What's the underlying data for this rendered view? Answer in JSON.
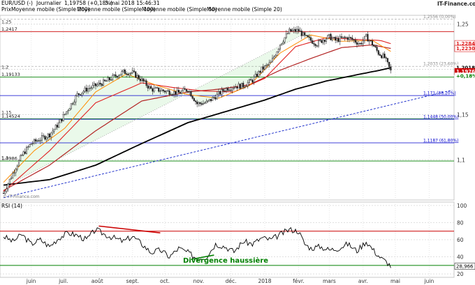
{
  "header": {
    "symbol": "EUR/USD (-)",
    "period": "Journalier",
    "price": "1,19758 (+0,18%)",
    "datetime": "3 mai 2018 15:46:31",
    "brand": "IT-Finance.com",
    "watermark": "© IT-Finance.com"
  },
  "legend": {
    "label": "Prix",
    "items": [
      {
        "text": "Moyenne mobile (Simple 200)",
        "color": "#000000"
      },
      {
        "text": "Moyenne mobile (Simple 100)",
        "color": "#b22222"
      },
      {
        "text": "Moyenne mobile (Simple 50)",
        "color": "#e02020"
      },
      {
        "text": "Moyenne mobile (Simple 20)",
        "color": "#ff8c00"
      }
    ]
  },
  "colors": {
    "candle": "#222222",
    "ma200": "#000000",
    "ma100": "#b22222",
    "ma50": "#e02020",
    "ma20": "#ff8c00",
    "resistance": "#cc0000",
    "support": "#008000",
    "fib": "#0000cc",
    "trend_fill": "#e8f8e8",
    "rsi_line": "#000000",
    "rsi_div_bear": "#cc0000",
    "rsi_div_bull": "#008000",
    "price_badge_pos": "#008000"
  },
  "chart_data": [
    {
      "type": "line",
      "name": "price-panel",
      "ylim": [
        1.0555,
        1.2597
      ],
      "yticks": [
        {
          "value": 1.25,
          "label": "1,25"
        },
        {
          "value": 1.2,
          "label": "1,2"
        },
        {
          "value": 1.15,
          "label": "1,15"
        },
        {
          "value": 1.1,
          "label": "1,1"
        }
      ],
      "xticks": [
        {
          "t": 18,
          "label": "juin"
        },
        {
          "t": 39,
          "label": "juil."
        },
        {
          "t": 61,
          "label": "août"
        },
        {
          "t": 84,
          "label": "sept."
        },
        {
          "t": 105,
          "label": "oct."
        },
        {
          "t": 127,
          "label": "nov."
        },
        {
          "t": 148,
          "label": "déc."
        },
        {
          "t": 170,
          "label": "2018"
        },
        {
          "t": 192,
          "label": "févr."
        },
        {
          "t": 212,
          "label": "mars"
        },
        {
          "t": 234,
          "label": "avr."
        },
        {
          "t": 255,
          "label": "mai"
        },
        {
          "t": 277,
          "label": "juin"
        }
      ],
      "levels_left": [
        {
          "value": 1.2417,
          "label": "1,2417",
          "color": "#cc0000"
        },
        {
          "value": 1.19133,
          "label": "1,19133",
          "color": "#008000"
        },
        {
          "value": 1.14524,
          "label": "1,14524",
          "color": "#008000"
        },
        {
          "value": 1.0986,
          "label": "1,0986",
          "color": "#008000"
        }
      ],
      "levels_right": [
        {
          "value": 1.2556,
          "label": "1,2556 (0,00%)",
          "color": "#888888"
        },
        {
          "value": 1.2033,
          "label": "1,2033 (23,60%)",
          "color": "#888888"
        },
        {
          "value": 1.171,
          "label": "1,171 (38,20%)",
          "color": "#0000cc"
        },
        {
          "value": 1.1448,
          "label": "1,1448 (50,00%)",
          "color": "#0000cc"
        },
        {
          "value": 1.1187,
          "label": "1,1187 (61,80%)",
          "color": "#0000cc"
        }
      ],
      "price_badges": [
        {
          "value": 1.22842,
          "label": "1,22842",
          "color": "#e02020"
        },
        {
          "value": 1.22306,
          "label": "1,22306",
          "color": "#e02020"
        },
        {
          "value": 1.22301,
          "label": "1,22301",
          "color": "#e02020"
        },
        {
          "value": 1.20183,
          "label": "1,20183",
          "color": "#000000"
        },
        {
          "value": 1.19763,
          "label": "1,19763",
          "color": "#ffffff"
        },
        {
          "value": 1.1928,
          "label": "+0,18%",
          "color": "#008000"
        }
      ],
      "close_anchors": [
        [
          0,
          1.063
        ],
        [
          6,
          1.085
        ],
        [
          12,
          1.105
        ],
        [
          18,
          1.118
        ],
        [
          24,
          1.123
        ],
        [
          30,
          1.128
        ],
        [
          36,
          1.14
        ],
        [
          42,
          1.156
        ],
        [
          48,
          1.172
        ],
        [
          54,
          1.178
        ],
        [
          60,
          1.182
        ],
        [
          66,
          1.186
        ],
        [
          72,
          1.192
        ],
        [
          78,
          1.197
        ],
        [
          84,
          1.196
        ],
        [
          90,
          1.188
        ],
        [
          96,
          1.178
        ],
        [
          102,
          1.177
        ],
        [
          108,
          1.175
        ],
        [
          114,
          1.174
        ],
        [
          120,
          1.178
        ],
        [
          126,
          1.162
        ],
        [
          132,
          1.163
        ],
        [
          138,
          1.17
        ],
        [
          144,
          1.178
        ],
        [
          150,
          1.181
        ],
        [
          156,
          1.182
        ],
        [
          162,
          1.188
        ],
        [
          168,
          1.2
        ],
        [
          174,
          1.207
        ],
        [
          180,
          1.228
        ],
        [
          186,
          1.242
        ],
        [
          192,
          1.243
        ],
        [
          196,
          1.236
        ],
        [
          200,
          1.232
        ],
        [
          204,
          1.228
        ],
        [
          208,
          1.233
        ],
        [
          212,
          1.236
        ],
        [
          216,
          1.232
        ],
        [
          220,
          1.234
        ],
        [
          224,
          1.235
        ],
        [
          228,
          1.232
        ],
        [
          232,
          1.228
        ],
        [
          236,
          1.236
        ],
        [
          240,
          1.228
        ],
        [
          244,
          1.218
        ],
        [
          248,
          1.213
        ],
        [
          252,
          1.198
        ]
      ],
      "series": [
        {
          "name": "Moyenne mobile (Simple 200)",
          "points": [
            [
              0,
              1.072
            ],
            [
              30,
              1.078
            ],
            [
              60,
              1.094
            ],
            [
              90,
              1.118
            ],
            [
              120,
              1.141
            ],
            [
              150,
              1.156
            ],
            [
              170,
              1.166
            ],
            [
              190,
              1.178
            ],
            [
              210,
              1.187
            ],
            [
              230,
              1.194
            ],
            [
              245,
              1.199
            ],
            [
              252,
              1.2018
            ]
          ]
        },
        {
          "name": "Moyenne mobile (Simple 100)",
          "points": [
            [
              0,
              1.066
            ],
            [
              30,
              1.094
            ],
            [
              60,
              1.132
            ],
            [
              90,
              1.165
            ],
            [
              120,
              1.175
            ],
            [
              140,
              1.178
            ],
            [
              160,
              1.183
            ],
            [
              180,
              1.199
            ],
            [
              200,
              1.212
            ],
            [
              220,
              1.224
            ],
            [
              240,
              1.227
            ],
            [
              252,
              1.2231
            ]
          ]
        },
        {
          "name": "Moyenne mobile (Simple 50)",
          "points": [
            [
              0,
              1.065
            ],
            [
              30,
              1.11
            ],
            [
              60,
              1.163
            ],
            [
              90,
              1.185
            ],
            [
              110,
              1.18
            ],
            [
              130,
              1.176
            ],
            [
              150,
              1.175
            ],
            [
              170,
              1.19
            ],
            [
              190,
              1.225
            ],
            [
              210,
              1.235
            ],
            [
              230,
              1.233
            ],
            [
              245,
              1.232
            ],
            [
              252,
              1.2284
            ]
          ]
        },
        {
          "name": "Moyenne mobile (Simple 20)",
          "points": [
            [
              0,
              1.075
            ],
            [
              20,
              1.11
            ],
            [
              40,
              1.135
            ],
            [
              60,
              1.175
            ],
            [
              80,
              1.195
            ],
            [
              100,
              1.182
            ],
            [
              120,
              1.172
            ],
            [
              140,
              1.168
            ],
            [
              160,
              1.182
            ],
            [
              180,
              1.218
            ],
            [
              200,
              1.238
            ],
            [
              220,
              1.231
            ],
            [
              240,
              1.232
            ],
            [
              252,
              1.2198
            ]
          ]
        }
      ],
      "trendlines": [
        {
          "style": "dotted-gray",
          "from": [
            0,
            1.07
          ],
          "to": [
            200,
            1.243
          ]
        },
        {
          "style": "dashed-blue",
          "from": [
            0,
            1.058
          ],
          "to": [
            292,
            1.177
          ]
        }
      ]
    },
    {
      "type": "line",
      "name": "rsi-panel",
      "title": "RSI (14)",
      "ylim": [
        16,
        104
      ],
      "yticks": [
        {
          "value": 100,
          "label": "100"
        },
        {
          "value": 80,
          "label": "80"
        },
        {
          "value": 60,
          "label": "60"
        },
        {
          "value": 40,
          "label": "40"
        },
        {
          "value": 20,
          "label": "20"
        }
      ],
      "levels": [
        {
          "value": 70,
          "color": "#cc0000"
        },
        {
          "value": 30,
          "color": "#008000"
        }
      ],
      "last_value": {
        "value": 28.966,
        "label": "28,966"
      },
      "annotation": "Divergence haussière",
      "values_anchors": [
        [
          0,
          64
        ],
        [
          6,
          58
        ],
        [
          12,
          66
        ],
        [
          18,
          55
        ],
        [
          24,
          60
        ],
        [
          30,
          52
        ],
        [
          36,
          62
        ],
        [
          42,
          68
        ],
        [
          48,
          65
        ],
        [
          54,
          60
        ],
        [
          60,
          72
        ],
        [
          66,
          66
        ],
        [
          72,
          62
        ],
        [
          78,
          58
        ],
        [
          84,
          64
        ],
        [
          90,
          55
        ],
        [
          96,
          45
        ],
        [
          102,
          48
        ],
        [
          108,
          40
        ],
        [
          114,
          50
        ],
        [
          120,
          45
        ],
        [
          126,
          38
        ],
        [
          132,
          40
        ],
        [
          138,
          55
        ],
        [
          144,
          52
        ],
        [
          150,
          46
        ],
        [
          156,
          58
        ],
        [
          162,
          55
        ],
        [
          168,
          62
        ],
        [
          174,
          60
        ],
        [
          180,
          66
        ],
        [
          186,
          72
        ],
        [
          192,
          70
        ],
        [
          196,
          55
        ],
        [
          200,
          50
        ],
        [
          206,
          52
        ],
        [
          212,
          48
        ],
        [
          218,
          50
        ],
        [
          224,
          55
        ],
        [
          230,
          47
        ],
        [
          236,
          58
        ],
        [
          242,
          45
        ],
        [
          246,
          38
        ],
        [
          250,
          33
        ],
        [
          252,
          29
        ]
      ],
      "divergences": [
        {
          "style": "bearish",
          "from": [
            62,
            76
          ],
          "to": [
            102,
            68
          ]
        },
        {
          "style": "bullish",
          "from": [
            122,
            37
          ],
          "to": [
            137,
            42
          ]
        }
      ]
    }
  ]
}
